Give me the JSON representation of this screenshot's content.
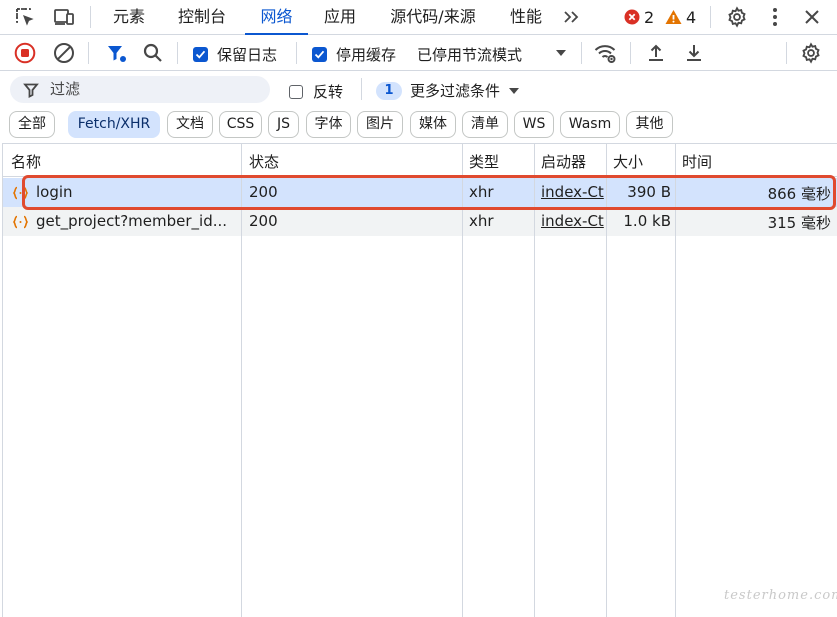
{
  "tabs": [
    {
      "label": "元素"
    },
    {
      "label": "控制台"
    },
    {
      "label": "网络"
    },
    {
      "label": "应用"
    },
    {
      "label": "源代码/来源"
    },
    {
      "label": "性能"
    }
  ],
  "badges": {
    "errors": "2",
    "warnings": "4"
  },
  "toolbar": {
    "preserve_log": "保留日志",
    "disable_cache": "停用缓存",
    "throttling": "已停用节流模式"
  },
  "filter": {
    "placeholder": "过滤",
    "invert_label": "反转",
    "more_count": "1",
    "more_label": "更多过滤条件"
  },
  "type_filters": [
    "全部",
    "Fetch/XHR",
    "文档",
    "CSS",
    "JS",
    "字体",
    "图片",
    "媒体",
    "清单",
    "WS",
    "Wasm",
    "其他"
  ],
  "table": {
    "headers": [
      "名称",
      "状态",
      "类型",
      "启动器",
      "大小",
      "时间"
    ],
    "rows": [
      {
        "name": "login",
        "status": "200",
        "type": "xhr",
        "initiator": "index-Ct",
        "size": "390 B",
        "time": "866 毫秒"
      },
      {
        "name": "get_project?member_id...",
        "status": "200",
        "type": "xhr",
        "initiator": "index-Ct",
        "size": "1.0 kB",
        "time": "315 毫秒"
      }
    ]
  },
  "watermark": "testerhome.com",
  "colors": {
    "accent": "#0b57d0",
    "selected_row": "#d3e3fd",
    "highlight": "#e04a2f",
    "record": "#d93025",
    "warning": "#e37400"
  }
}
